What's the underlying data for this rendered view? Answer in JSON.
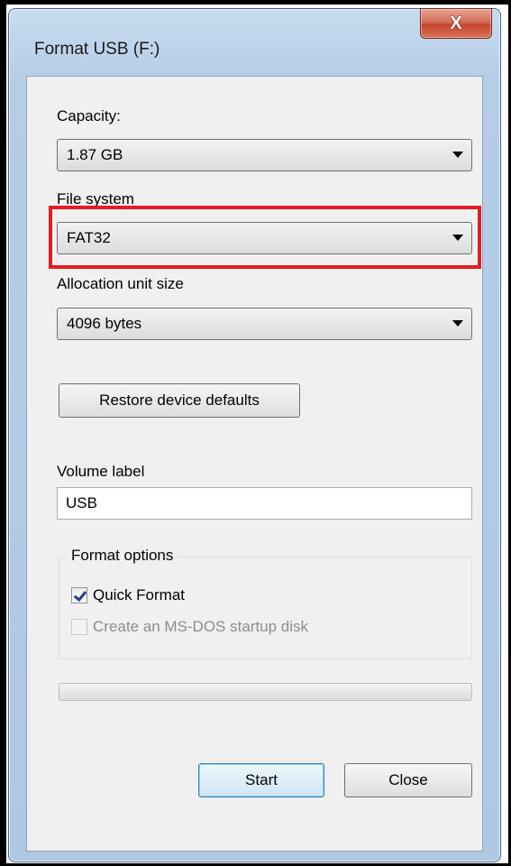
{
  "window": {
    "title": "Format USB (F:)",
    "close_glyph": "X"
  },
  "capacity": {
    "label": "Capacity:",
    "value": "1.87 GB"
  },
  "file_system": {
    "label": "File system",
    "value": "FAT32",
    "highlight_color": "#e31b23"
  },
  "allocation": {
    "label": "Allocation unit size",
    "value": "4096 bytes"
  },
  "restore_button": "Restore device defaults",
  "volume": {
    "label": "Volume label",
    "value": "USB"
  },
  "format_options": {
    "title": "Format options",
    "quick_format": {
      "label": "Quick Format",
      "checked": true
    },
    "msdos": {
      "label": "Create an MS-DOS startup disk",
      "checked": false,
      "disabled": true
    }
  },
  "progress": {
    "value": 0
  },
  "buttons": {
    "start": "Start",
    "close": "Close"
  }
}
